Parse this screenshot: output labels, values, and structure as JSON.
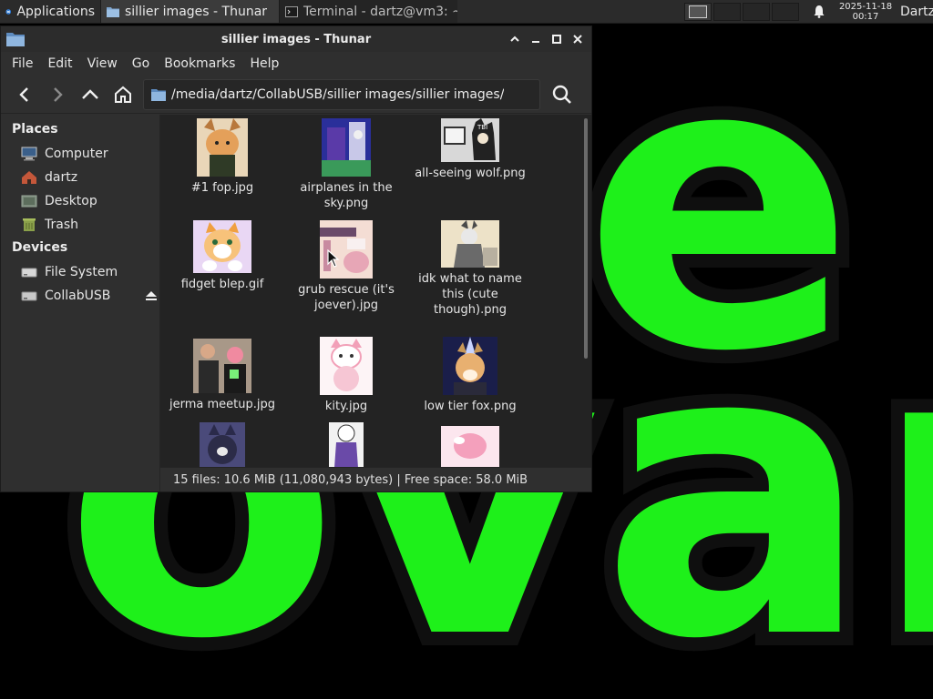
{
  "panel": {
    "apps_label": "Applications",
    "tasks": [
      {
        "label": "sillier images - Thunar"
      },
      {
        "label": "Terminal - dartz@vm3: ~"
      }
    ],
    "clock_date": "2025-11-18",
    "clock_time": "00:17",
    "user_label": "Dartz"
  },
  "window": {
    "title": "sillier images - Thunar",
    "menu": [
      "File",
      "Edit",
      "View",
      "Go",
      "Bookmarks",
      "Help"
    ],
    "location": "/media/dartz/CollabUSB/sillier images/sillier images/"
  },
  "sidebar": {
    "places_header": "Places",
    "places": [
      {
        "label": "Computer",
        "icon": "computer-icon"
      },
      {
        "label": "dartz",
        "icon": "home-folder-icon"
      },
      {
        "label": "Desktop",
        "icon": "desktop-icon"
      },
      {
        "label": "Trash",
        "icon": "trash-icon"
      }
    ],
    "devices_header": "Devices",
    "devices": [
      {
        "label": "File System",
        "icon": "drive-icon"
      },
      {
        "label": "CollabUSB",
        "icon": "usb-drive-icon"
      }
    ]
  },
  "files": [
    {
      "name": "#1 fop.jpg"
    },
    {
      "name": "airplanes in the sky.png"
    },
    {
      "name": "all-seeing wolf.png"
    },
    {
      "name": "fidget blep.gif"
    },
    {
      "name": "grub rescue (it's joever).jpg"
    },
    {
      "name": "idk what to name this (cute though).png"
    },
    {
      "name": "jerma meetup.jpg"
    },
    {
      "name": "kity.jpg"
    },
    {
      "name": "low tier fox.png"
    },
    {
      "name": ""
    },
    {
      "name": ""
    },
    {
      "name": ""
    }
  ],
  "status": "15 files: 10.6 MiB (11,080,943 bytes)  |  Free space: 58.0 MiB",
  "colors": {
    "wallpaper_text": "#1ef01a",
    "panel_bg": "#2b2b2b",
    "window_bg": "#2f2f2f",
    "view_bg": "#232323"
  }
}
